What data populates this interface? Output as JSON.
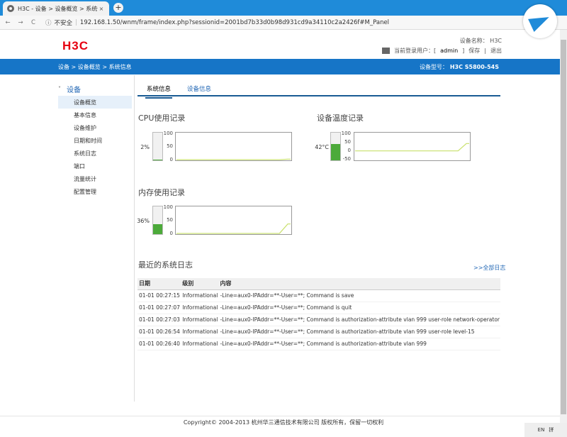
{
  "browser": {
    "tab_title": "H3C - 设备 > 设备概览 > 系统信息",
    "tab_close": "×",
    "new_tab": "+",
    "nav_back": "←",
    "nav_forward": "→",
    "nav_reload": "C",
    "insecure": "不安全",
    "url": "192.168.1.50/wnm/frame/index.php?sessionid=2001bd7b33d0b98d931cd9a34110c2a2426f#M_Panel"
  },
  "header": {
    "brand": "H3C",
    "device_name_label": "设备名称：",
    "device_name": "H3C",
    "current_user_label": "当前登录用户：[",
    "current_user": "admin",
    "bracket_close": "]",
    "save": "保存",
    "pipe": "|",
    "logout": "退出"
  },
  "bluebar": {
    "breadcrumb": "设备 > 设备概览 > 系统信息",
    "model_label": "设备型号：",
    "model": "H3C S5800-54S"
  },
  "leftnav": {
    "group": "设备",
    "items": [
      "设备概览",
      "基本信息",
      "设备维护",
      "日期和时间",
      "系统日志",
      "端口",
      "流量统计",
      "配置管理"
    ]
  },
  "tabs": [
    "系统信息",
    "设备信息"
  ],
  "charts": {
    "cpu": {
      "title": "CPU使用记录",
      "value": "2%",
      "fill": 0.02,
      "ticks": [
        "100",
        "50",
        "0"
      ],
      "series": [
        0,
        0,
        0,
        0,
        0,
        0,
        0,
        0,
        0,
        0,
        2
      ]
    },
    "temp": {
      "title": "设备温度记录",
      "value": "42°C",
      "fill": 0.6,
      "ticks": [
        "100",
        "50",
        "0",
        "-50"
      ],
      "series": [
        0,
        0,
        0,
        0,
        0,
        0,
        0,
        0,
        0,
        0,
        42
      ]
    },
    "mem": {
      "title": "内存使用记录",
      "value": "36%",
      "fill": 0.36,
      "ticks": [
        "100",
        "50",
        "0"
      ],
      "series": [
        0,
        0,
        0,
        0,
        0,
        0,
        0,
        0,
        0,
        0,
        36
      ]
    }
  },
  "logs": {
    "title": "最近的系统日志",
    "all_link": ">>全部日志",
    "columns": [
      "日期",
      "级别",
      "内容"
    ],
    "rows": [
      [
        "01-01 00:27:15",
        "Informational",
        "-Line=aux0-IPAddr=**-User=**; Command is save"
      ],
      [
        "01-01 00:27:07",
        "Informational",
        "-Line=aux0-IPAddr=**-User=**; Command is quit"
      ],
      [
        "01-01 00:27:03",
        "Informational",
        "-Line=aux0-IPAddr=**-User=**; Command is authorization-attribute vlan 999 user-role network-operator"
      ],
      [
        "01-01 00:26:54",
        "Informational",
        "-Line=aux0-IPAddr=**-User=**; Command is authorization-attribute vlan 999 user-role level-15"
      ],
      [
        "01-01 00:26:40",
        "Informational",
        "-Line=aux0-IPAddr=**-User=**; Command is authorization-attribute vlan 999"
      ]
    ]
  },
  "footer": "Copyright© 2004-2013 杭州华三通信技术有限公司 版权所有，保留一切权利",
  "taskbar": {
    "lang": "EN",
    "input": "拼"
  },
  "colors": {
    "accent": "#1675c7",
    "brand": "#e60012",
    "gauge": "#4caa3a",
    "line": "#c8e06a"
  }
}
